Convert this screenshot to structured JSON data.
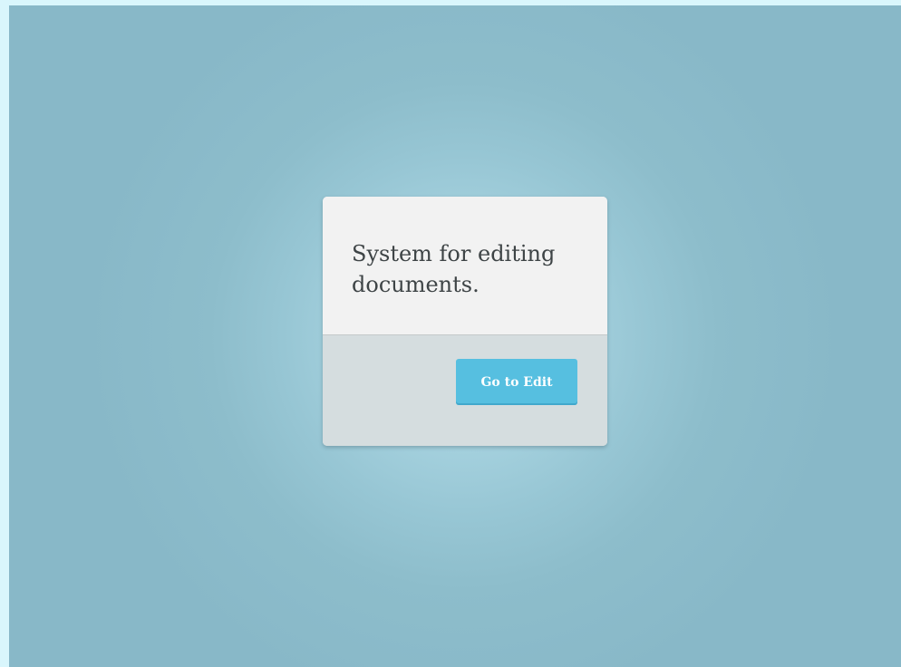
{
  "dialog": {
    "message": "System for editing documents.",
    "button_label": "Go to Edit"
  },
  "colors": {
    "page_border": "#d9f6fc",
    "background": "#88b8c8",
    "card_body": "#f2f2f2",
    "card_footer": "#d5dddf",
    "button": "#56bfe0",
    "text": "#3e4446"
  }
}
